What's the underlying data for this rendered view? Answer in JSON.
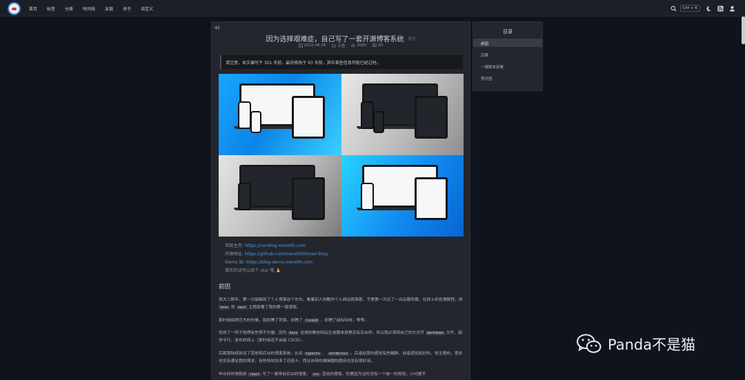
{
  "nav": {
    "items": [
      "首页",
      "标签",
      "分类",
      "时间线",
      "友链",
      "关于",
      "自定义"
    ],
    "search_shortcut": "Ctrl + K"
  },
  "article": {
    "title": "因为选择艰难症，自己写了一套开源博客系统",
    "badge": "置顶",
    "meta": {
      "date": "2022-08-26",
      "category": "公告",
      "views": "3085",
      "comments": "65"
    },
    "notice": "请注意，本文编写于 301 天前，最后修改于 93 天前，其中某些信息可能已经过时。",
    "links": [
      {
        "label": "项目主页:",
        "url": "https://vanblog.mereith.com"
      },
      {
        "label": "开源地址:",
        "url": "https://github.com/mereithhh/van-blog"
      },
      {
        "label": "Demo 站:",
        "url": "https://blog-demo.mereith.com"
      }
    ],
    "star_line": "喜欢的话可以给个 star 哦 🙏",
    "section_heading": "前因",
    "paragraphs": {
      "p1_a": "我大二那年，第一次接触到了个人博客这个东东。看着别人炫酷的个人网站很羡慕，于是第一次买了一台云服务器，在网上到处搜教程，用",
      "p1_code1": "hexo",
      "p1_b": "和",
      "p1_code2": "next",
      "p1_c": "主题部署了我的第一版博客。",
      "p2_a": "那时候搞得巨大的热情，我折腾了背景，折腾了",
      "p2_code": "live2d",
      "p2_b": "，折腾了鼠标特效，等等。",
      "p3_a": "但用了一阵子觉得有些很不方便。因为",
      "p3_code1": "hexo",
      "p3_b": "这类的静态网站生成器本身是没有后台的，所以我必须用自己的方式写",
      "p3_code2": "markdown",
      "p3_c": "文件、敲命令行、发布到网上（那时候还不会搞 CI/CD）。",
      "p4_a": "后面我陆续尝试了其他带后台的博客系统，比如",
      "p4_code1": "typecho",
      "p4_b": "、",
      "p4_code2": "wordpress",
      "p4_c": "。后者给我的感觉有些臃肿，前者感觉挺好的，但主题的，很多也没有满足我的需求，有些特效加多了还挺卡，而且自带的编辑器和图床也没有很好用。",
      "p5_a": "毕业的时候我用",
      "p5_code1": "react",
      "p5_b": "写了一套带前后台的博客，",
      "p5_code2": "ssr",
      "p5_c": "渲染的博客。但是因为当时没有一个统一的规划，小问题不"
    }
  },
  "toc": {
    "title": "目录",
    "items": [
      "前因",
      "后果",
      "一键脚本部署",
      "预览图"
    ],
    "active_index": 0
  },
  "watermark": {
    "text": "Panda不是猫"
  }
}
